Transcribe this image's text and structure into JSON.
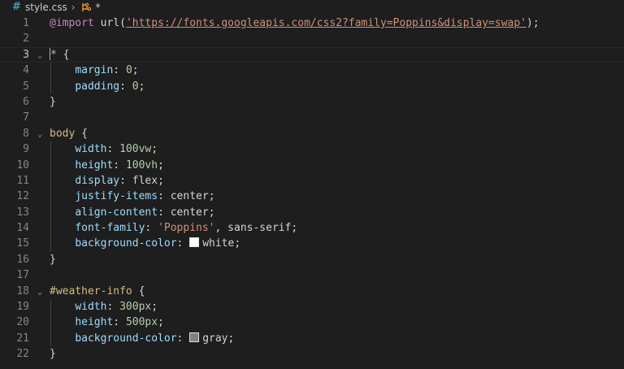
{
  "breadcrumb": {
    "file_icon": "#",
    "file_name": "style.css",
    "chevron": "›",
    "symbol_icon": "css-selector-icon",
    "symbol": "*"
  },
  "colors": {
    "background": "#1e1e1e",
    "line_number": "#858585",
    "at_rule": "#c586c0",
    "string": "#ce9178",
    "selector": "#d7ba7d",
    "property": "#9cdcfe",
    "number": "#b5cea8",
    "swatch_white": "#ffffff",
    "swatch_gray": "#808080"
  },
  "lines": [
    {
      "n": "1",
      "tokens": [
        [
          "at",
          "@import"
        ],
        [
          "plain",
          " url("
        ],
        [
          "url",
          "'https://fonts.googleapis.com/css2?family=Poppins&display=swap'"
        ],
        [
          "plain",
          ");"
        ]
      ]
    },
    {
      "n": "2",
      "tokens": []
    },
    {
      "n": "3",
      "fold": "⌄",
      "cursor": true,
      "tokens": [
        [
          "sel",
          "*"
        ],
        [
          "plain",
          " {"
        ]
      ]
    },
    {
      "n": "4",
      "tokens": [
        [
          "plain",
          "    "
        ],
        [
          "prop",
          "margin"
        ],
        [
          "plain",
          ": "
        ],
        [
          "num",
          "0"
        ],
        [
          "plain",
          ";"
        ]
      ]
    },
    {
      "n": "5",
      "tokens": [
        [
          "plain",
          "    "
        ],
        [
          "prop",
          "padding"
        ],
        [
          "plain",
          ": "
        ],
        [
          "num",
          "0"
        ],
        [
          "plain",
          ";"
        ]
      ]
    },
    {
      "n": "6",
      "tokens": [
        [
          "plain",
          "}"
        ]
      ]
    },
    {
      "n": "7",
      "tokens": []
    },
    {
      "n": "8",
      "fold": "⌄",
      "tokens": [
        [
          "sel",
          "body"
        ],
        [
          "plain",
          " {"
        ]
      ]
    },
    {
      "n": "9",
      "tokens": [
        [
          "plain",
          "    "
        ],
        [
          "prop",
          "width"
        ],
        [
          "plain",
          ": "
        ],
        [
          "num",
          "100vw"
        ],
        [
          "plain",
          ";"
        ]
      ]
    },
    {
      "n": "10",
      "tokens": [
        [
          "plain",
          "    "
        ],
        [
          "prop",
          "height"
        ],
        [
          "plain",
          ": "
        ],
        [
          "num",
          "100vh"
        ],
        [
          "plain",
          ";"
        ]
      ]
    },
    {
      "n": "11",
      "tokens": [
        [
          "plain",
          "    "
        ],
        [
          "prop",
          "display"
        ],
        [
          "plain",
          ": "
        ],
        [
          "plain",
          "flex"
        ],
        [
          "plain",
          ";"
        ]
      ]
    },
    {
      "n": "12",
      "tokens": [
        [
          "plain",
          "    "
        ],
        [
          "prop",
          "justify-items"
        ],
        [
          "plain",
          ": "
        ],
        [
          "plain",
          "center"
        ],
        [
          "plain",
          ";"
        ]
      ]
    },
    {
      "n": "13",
      "tokens": [
        [
          "plain",
          "    "
        ],
        [
          "prop",
          "align-content"
        ],
        [
          "plain",
          ": "
        ],
        [
          "plain",
          "center"
        ],
        [
          "plain",
          ";"
        ]
      ]
    },
    {
      "n": "14",
      "tokens": [
        [
          "plain",
          "    "
        ],
        [
          "prop",
          "font-family"
        ],
        [
          "plain",
          ": "
        ],
        [
          "str",
          "'Poppins'"
        ],
        [
          "plain",
          ", sans-serif;"
        ]
      ]
    },
    {
      "n": "15",
      "tokens": [
        [
          "plain",
          "    "
        ],
        [
          "prop",
          "background-color"
        ],
        [
          "plain",
          ": "
        ],
        [
          "swatch",
          "#ffffff"
        ],
        [
          "plain",
          "white"
        ],
        [
          "plain",
          ";"
        ]
      ]
    },
    {
      "n": "16",
      "tokens": [
        [
          "plain",
          "}"
        ]
      ]
    },
    {
      "n": "17",
      "tokens": []
    },
    {
      "n": "18",
      "fold": "⌄",
      "tokens": [
        [
          "sel",
          "#weather-info"
        ],
        [
          "plain",
          " {"
        ]
      ]
    },
    {
      "n": "19",
      "tokens": [
        [
          "plain",
          "    "
        ],
        [
          "prop",
          "width"
        ],
        [
          "plain",
          ": "
        ],
        [
          "num",
          "300px"
        ],
        [
          "plain",
          ";"
        ]
      ]
    },
    {
      "n": "20",
      "tokens": [
        [
          "plain",
          "    "
        ],
        [
          "prop",
          "height"
        ],
        [
          "plain",
          ": "
        ],
        [
          "num",
          "500px"
        ],
        [
          "plain",
          ";"
        ]
      ]
    },
    {
      "n": "21",
      "tokens": [
        [
          "plain",
          "    "
        ],
        [
          "prop",
          "background-color"
        ],
        [
          "plain",
          ": "
        ],
        [
          "swatch",
          "#808080"
        ],
        [
          "plain",
          "gray"
        ],
        [
          "plain",
          ";"
        ]
      ]
    },
    {
      "n": "22",
      "tokens": [
        [
          "plain",
          "}"
        ]
      ]
    }
  ]
}
